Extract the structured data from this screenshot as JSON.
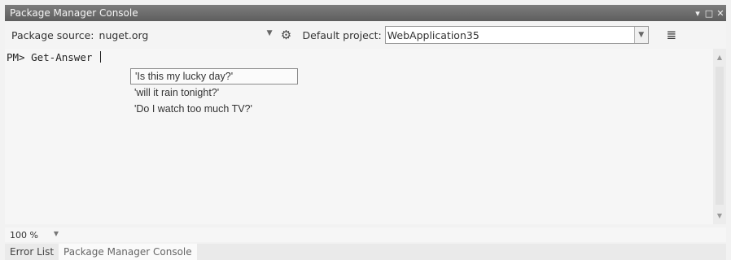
{
  "window": {
    "title": "Package Manager Console",
    "controls": {
      "dropdown": "▾",
      "maximize": "□",
      "close": "✕"
    }
  },
  "toolbar": {
    "source_label": "Package source:",
    "source_value": "nuget.org",
    "project_label": "Default project:",
    "project_value": "WebApplication35"
  },
  "console": {
    "prompt": "PM>",
    "command": "Get-Answer"
  },
  "autocomplete": {
    "items": [
      {
        "label": "'Is this my lucky day?'",
        "selected": true
      },
      {
        "label": "'will it rain tonight?'",
        "selected": false
      },
      {
        "label": "'Do I watch too much TV?'",
        "selected": false
      }
    ]
  },
  "status": {
    "zoom": "100 %"
  },
  "tabs": [
    {
      "label": "Error List",
      "active": false
    },
    {
      "label": "Package Manager Console",
      "active": true
    }
  ],
  "icons": {
    "settings": "gear-icon",
    "clear": "clear-console-icon"
  }
}
